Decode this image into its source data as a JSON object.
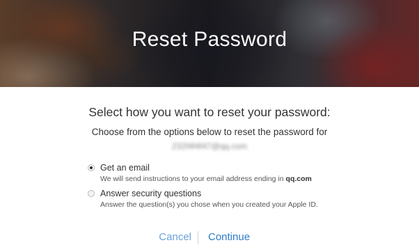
{
  "hero": {
    "title": "Reset Password"
  },
  "main": {
    "heading": "Select how you want to reset your password:",
    "subheading": "Choose from the options below to reset the password for",
    "email_masked": "232f4f4f47@qq.com"
  },
  "options": [
    {
      "label": "Get an email",
      "description_prefix": "We will send instructions to your email address ending in ",
      "description_emphasis": "qq.com",
      "selected": true
    },
    {
      "label": "Answer security questions",
      "description": "Answer the question(s) you chose when you created your Apple ID.",
      "selected": false
    }
  ],
  "actions": {
    "cancel_label": "Cancel",
    "continue_label": "Continue"
  },
  "colors": {
    "link_light": "#6aa2d8",
    "link_primary": "#2f7dc8",
    "text": "#333333"
  }
}
